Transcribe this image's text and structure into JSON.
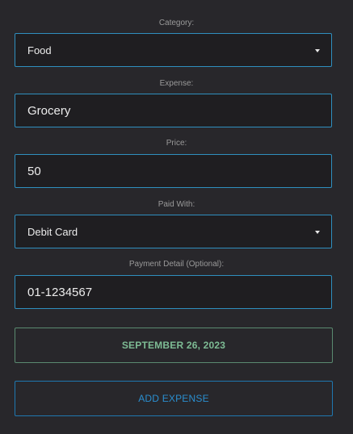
{
  "category": {
    "label": "Category:",
    "value": "Food"
  },
  "expense": {
    "label": "Expense:",
    "value": "Grocery"
  },
  "price": {
    "label": "Price:",
    "value": "50"
  },
  "paid_with": {
    "label": "Paid With:",
    "value": "Debit Card"
  },
  "payment_detail": {
    "label": "Payment Detail (Optional):",
    "value": "01-1234567"
  },
  "date_button": {
    "label": "SEPTEMBER 26, 2023"
  },
  "add_button": {
    "label": "ADD EXPENSE"
  },
  "icons": {
    "select_caret": "caret-down-icon"
  },
  "colors": {
    "background": "#28272b",
    "field_background": "#1f1e21",
    "field_border": "#2f8fbf",
    "date_button_border": "#5a8a70",
    "date_button_text": "#7dbb94",
    "add_button_border": "#1f78b0",
    "add_button_text": "#2a8fd0"
  }
}
